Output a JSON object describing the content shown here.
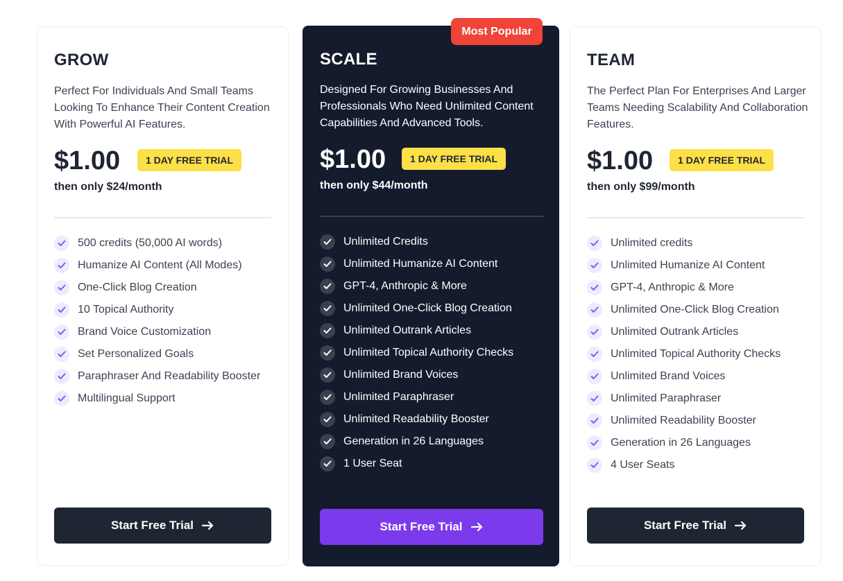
{
  "colors": {
    "dark_card": "#141b2d",
    "accent_purple": "#7c3aed",
    "popular_red": "#f04438",
    "trial_yellow": "#fde047"
  },
  "icons": {
    "feature": "check-icon",
    "cta": "arrow-right-icon"
  },
  "plans": [
    {
      "name": "GROW",
      "description": "Perfect For Individuals And Small Teams Looking To Enhance Their Content Creation With Powerful AI Features.",
      "price": "$1.00",
      "trial": "1 DAY FREE TRIAL",
      "then": "then only $24/month",
      "features": [
        "500 credits (50,000 AI words)",
        "Humanize AI Content (All Modes)",
        "One-Click Blog Creation",
        "10 Topical Authority",
        "Brand Voice Customization",
        "Set Personalized Goals",
        "Paraphraser And Readability Booster",
        "Multilingual Support"
      ],
      "cta": "Start Free Trial"
    },
    {
      "name": "SCALE",
      "badge": "Most Popular",
      "description": "Designed For Growing Businesses And Professionals Who Need Unlimited Content Capabilities And Advanced Tools.",
      "price": "$1.00",
      "trial": "1 DAY FREE TRIAL",
      "then": "then only $44/month",
      "features": [
        "Unlimited Credits",
        "Unlimited Humanize AI Content",
        "GPT-4, Anthropic & More",
        "Unlimited One-Click Blog Creation",
        "Unlimited Outrank Articles",
        "Unlimited Topical Authority Checks",
        "Unlimited Brand Voices",
        "Unlimited Paraphraser",
        "Unlimited Readability Booster",
        "Generation in 26 Languages",
        "1 User Seat"
      ],
      "cta": "Start Free Trial"
    },
    {
      "name": "TEAM",
      "description": "The Perfect Plan For Enterprises And Larger Teams Needing Scalability And Collaboration Features.",
      "price": "$1.00",
      "trial": "1 DAY FREE TRIAL",
      "then": "then only $99/month",
      "features": [
        "Unlimited credits",
        "Unlimited Humanize AI Content",
        "GPT-4, Anthropic & More",
        "Unlimited One-Click Blog Creation",
        "Unlimited Outrank Articles",
        "Unlimited Topical Authority Checks",
        "Unlimited Brand Voices",
        "Unlimited Paraphraser",
        "Unlimited Readability Booster",
        "Generation in 26 Languages",
        "4 User Seats"
      ],
      "cta": "Start Free Trial"
    }
  ]
}
